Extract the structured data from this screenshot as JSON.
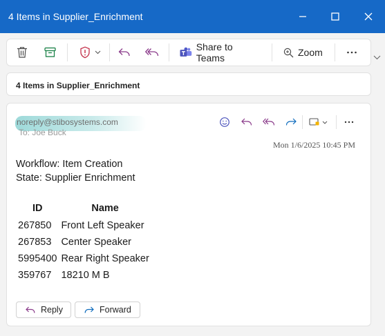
{
  "window": {
    "title": "4 Items in Supplier_Enrichment"
  },
  "toolbar": {
    "delete_icon": "trash-icon",
    "archive_icon": "archive-icon",
    "report_icon": "shield-icon",
    "reply_icon": "reply-icon",
    "reply_all_icon": "reply-all-icon",
    "share_to_teams_label": "Share to Teams",
    "zoom_label": "Zoom",
    "more_icon": "more-icon"
  },
  "subject": "4 Items in Supplier_Enrichment",
  "message": {
    "sender": "noreply@stibosystems.com",
    "to": "To: Joe Buck",
    "date": "Mon 1/6/2025 10:45 PM",
    "workflow_line": "Workflow: Item Creation",
    "state_line": "State: Supplier Enrichment",
    "table": {
      "headers": [
        "ID",
        "Name"
      ],
      "rows": [
        [
          "267850",
          "Front Left Speaker"
        ],
        [
          "267853",
          "Center Speaker"
        ],
        [
          "5995400",
          "Rear Right Speaker"
        ],
        [
          "359767",
          "18210 M B"
        ]
      ]
    },
    "reply_label": "Reply",
    "forward_label": "Forward"
  },
  "colors": {
    "titlebar": "#1669c7",
    "accent_purple": "#8a3a8a",
    "teams": "#5059c9",
    "forward_blue": "#0f6cbd"
  }
}
